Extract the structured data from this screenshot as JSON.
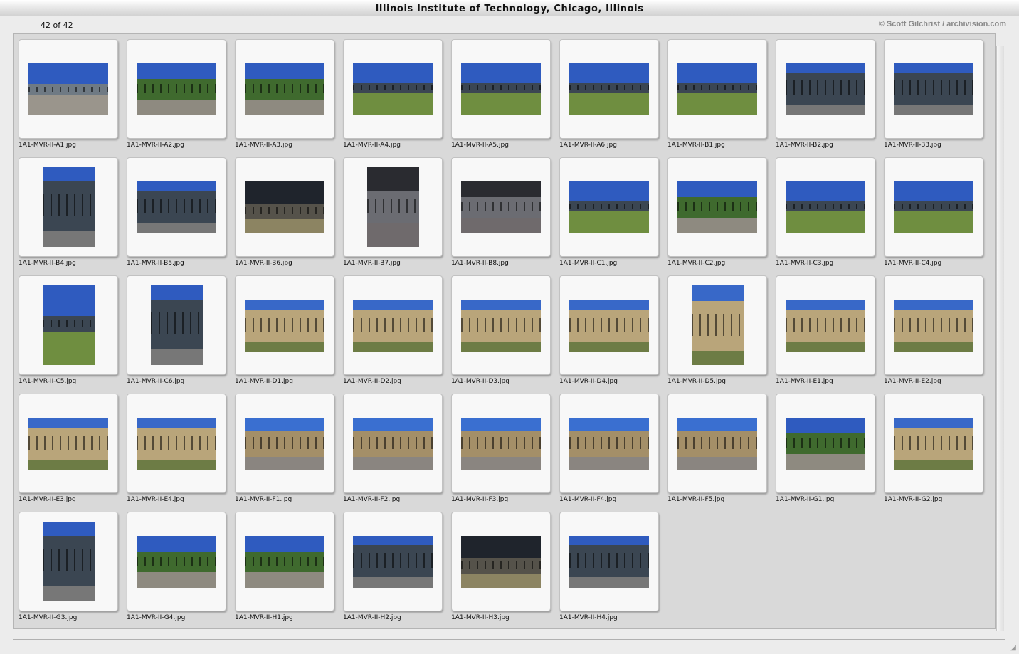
{
  "window": {
    "title": "Illinois Institute of Technology, Chicago, Illinois"
  },
  "status": {
    "count": "42 of 42",
    "credit": "© Scott Gilchrist / archivision.com"
  },
  "colors": {
    "sky": "#2f5bbf",
    "grass": "#6f8e40",
    "glass": "#3b4652",
    "brick": "#b9a57a",
    "pavement": "#8a8580"
  },
  "thumbnails": [
    {
      "filename": "1A1-MVR-II-A1.jpg",
      "orientation": "landscape",
      "scene": "campus-walk"
    },
    {
      "filename": "1A1-MVR-II-A2.jpg",
      "orientation": "landscape",
      "scene": "trees-lawn"
    },
    {
      "filename": "1A1-MVR-II-A3.jpg",
      "orientation": "landscape",
      "scene": "trees-lawn"
    },
    {
      "filename": "1A1-MVR-II-A4.jpg",
      "orientation": "landscape",
      "scene": "glass-pavilion"
    },
    {
      "filename": "1A1-MVR-II-A5.jpg",
      "orientation": "landscape",
      "scene": "glass-pavilion"
    },
    {
      "filename": "1A1-MVR-II-A6.jpg",
      "orientation": "landscape",
      "scene": "glass-pavilion"
    },
    {
      "filename": "1A1-MVR-II-B1.jpg",
      "orientation": "landscape",
      "scene": "glass-pavilion"
    },
    {
      "filename": "1A1-MVR-II-B2.jpg",
      "orientation": "landscape",
      "scene": "glass-facade"
    },
    {
      "filename": "1A1-MVR-II-B3.jpg",
      "orientation": "landscape",
      "scene": "glass-facade"
    },
    {
      "filename": "1A1-MVR-II-B4.jpg",
      "orientation": "portrait",
      "scene": "glass-facade"
    },
    {
      "filename": "1A1-MVR-II-B5.jpg",
      "orientation": "landscape",
      "scene": "glass-facade"
    },
    {
      "filename": "1A1-MVR-II-B6.jpg",
      "orientation": "landscape",
      "scene": "dark-base"
    },
    {
      "filename": "1A1-MVR-II-B7.jpg",
      "orientation": "portrait",
      "scene": "interior"
    },
    {
      "filename": "1A1-MVR-II-B8.jpg",
      "orientation": "landscape",
      "scene": "interior"
    },
    {
      "filename": "1A1-MVR-II-C1.jpg",
      "orientation": "landscape",
      "scene": "glass-pavilion"
    },
    {
      "filename": "1A1-MVR-II-C2.jpg",
      "orientation": "landscape",
      "scene": "trees-lawn"
    },
    {
      "filename": "1A1-MVR-II-C3.jpg",
      "orientation": "landscape",
      "scene": "glass-pavilion"
    },
    {
      "filename": "1A1-MVR-II-C4.jpg",
      "orientation": "landscape",
      "scene": "glass-pavilion"
    },
    {
      "filename": "1A1-MVR-II-C5.jpg",
      "orientation": "portrait",
      "scene": "glass-pavilion"
    },
    {
      "filename": "1A1-MVR-II-C6.jpg",
      "orientation": "portrait",
      "scene": "glass-facade"
    },
    {
      "filename": "1A1-MVR-II-D1.jpg",
      "orientation": "landscape",
      "scene": "brick-building"
    },
    {
      "filename": "1A1-MVR-II-D2.jpg",
      "orientation": "landscape",
      "scene": "brick-building"
    },
    {
      "filename": "1A1-MVR-II-D3.jpg",
      "orientation": "landscape",
      "scene": "brick-building"
    },
    {
      "filename": "1A1-MVR-II-D4.jpg",
      "orientation": "landscape",
      "scene": "brick-building"
    },
    {
      "filename": "1A1-MVR-II-D5.jpg",
      "orientation": "portrait",
      "scene": "brick-building"
    },
    {
      "filename": "1A1-MVR-II-E1.jpg",
      "orientation": "landscape",
      "scene": "brick-building"
    },
    {
      "filename": "1A1-MVR-II-E2.jpg",
      "orientation": "landscape",
      "scene": "brick-building"
    },
    {
      "filename": "1A1-MVR-II-E3.jpg",
      "orientation": "landscape",
      "scene": "brick-building"
    },
    {
      "filename": "1A1-MVR-II-E4.jpg",
      "orientation": "landscape",
      "scene": "brick-building"
    },
    {
      "filename": "1A1-MVR-II-F1.jpg",
      "orientation": "landscape",
      "scene": "industrial"
    },
    {
      "filename": "1A1-MVR-II-F2.jpg",
      "orientation": "landscape",
      "scene": "industrial"
    },
    {
      "filename": "1A1-MVR-II-F3.jpg",
      "orientation": "landscape",
      "scene": "industrial"
    },
    {
      "filename": "1A1-MVR-II-F4.jpg",
      "orientation": "landscape",
      "scene": "industrial"
    },
    {
      "filename": "1A1-MVR-II-F5.jpg",
      "orientation": "landscape",
      "scene": "industrial"
    },
    {
      "filename": "1A1-MVR-II-G1.jpg",
      "orientation": "landscape",
      "scene": "trees-lawn"
    },
    {
      "filename": "1A1-MVR-II-G2.jpg",
      "orientation": "landscape",
      "scene": "brick-building"
    },
    {
      "filename": "1A1-MVR-II-G3.jpg",
      "orientation": "portrait",
      "scene": "glass-facade"
    },
    {
      "filename": "1A1-MVR-II-G4.jpg",
      "orientation": "landscape",
      "scene": "trees-lawn"
    },
    {
      "filename": "1A1-MVR-II-H1.jpg",
      "orientation": "landscape",
      "scene": "trees-lawn"
    },
    {
      "filename": "1A1-MVR-II-H2.jpg",
      "orientation": "landscape",
      "scene": "glass-facade"
    },
    {
      "filename": "1A1-MVR-II-H3.jpg",
      "orientation": "landscape",
      "scene": "dark-base"
    },
    {
      "filename": "1A1-MVR-II-H4.jpg",
      "orientation": "landscape",
      "scene": "glass-facade"
    }
  ]
}
